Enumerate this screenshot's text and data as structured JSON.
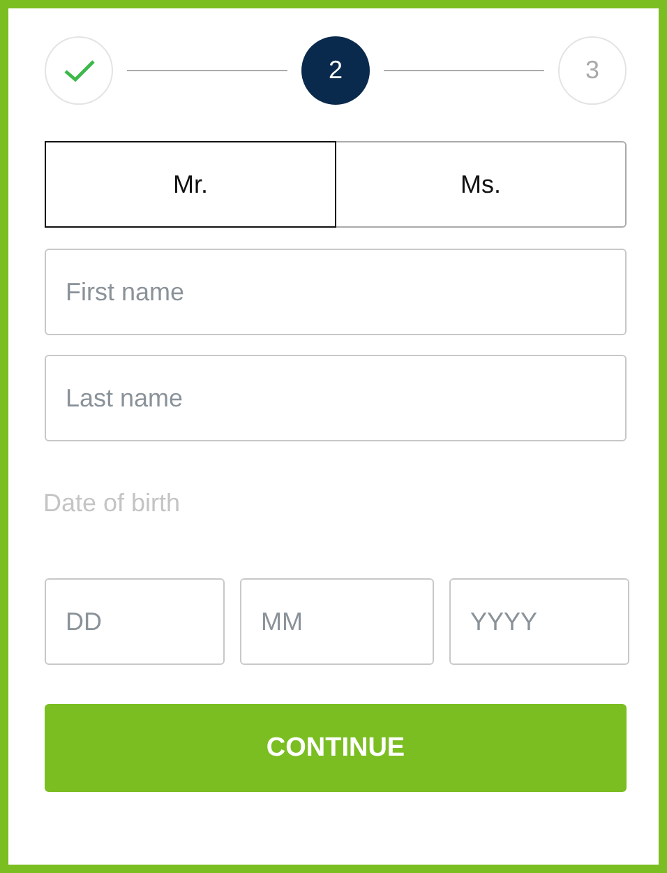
{
  "steps": [
    {
      "kind": "done"
    },
    {
      "kind": "current",
      "label": "2"
    },
    {
      "kind": "upcoming",
      "label": "3"
    }
  ],
  "title_options": [
    {
      "label": "Mr.",
      "selected": true
    },
    {
      "label": "Ms.",
      "selected": false
    }
  ],
  "name_fields": [
    {
      "placeholder": "First name"
    },
    {
      "placeholder": "Last name"
    }
  ],
  "date_of_birth": {
    "label": "Date of birth",
    "fields": [
      {
        "placeholder": "DD"
      },
      {
        "placeholder": "MM"
      },
      {
        "placeholder": "YYYY"
      }
    ]
  },
  "continue_button": "CONTINUE"
}
